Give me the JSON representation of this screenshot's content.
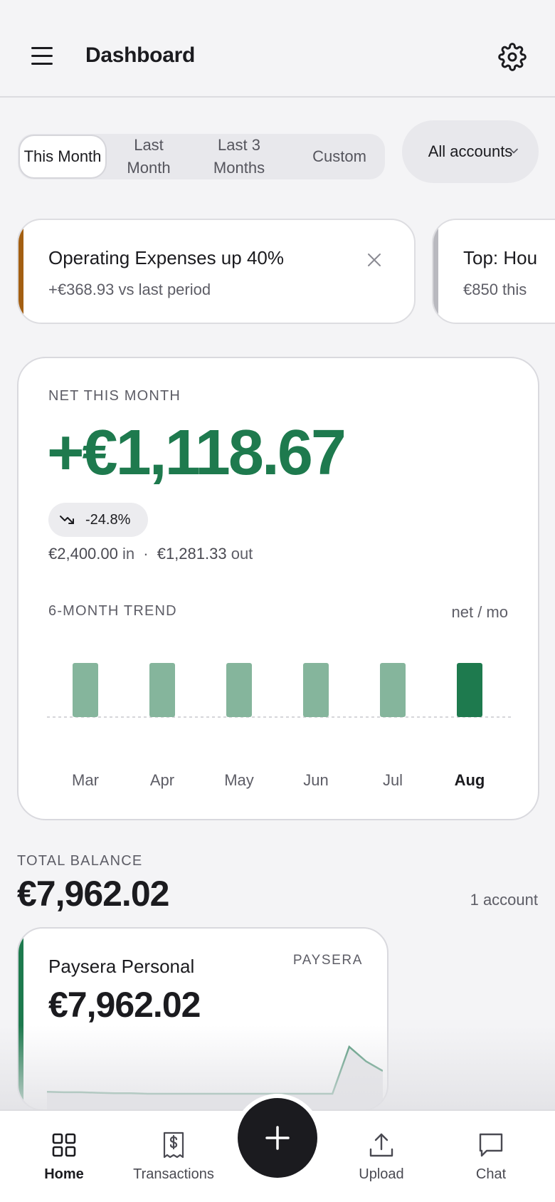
{
  "header": {
    "title": "Dashboard"
  },
  "period_tabs": [
    {
      "label": "This Month",
      "active": true
    },
    {
      "label": "Last Month",
      "active": false
    },
    {
      "label": "Last 3 Months",
      "active": false
    },
    {
      "label": "Custom",
      "active": false
    }
  ],
  "accounts_filter": {
    "label": "All accounts"
  },
  "insights": [
    {
      "title": "Operating Expenses up 40%",
      "subtitle": "+€368.93 vs last period",
      "accent_color": "#a35f12"
    },
    {
      "title": "Top: Hou",
      "subtitle": "€850 this",
      "accent_color": "#b9b9bf"
    }
  ],
  "net": {
    "label": "NET THIS MONTH",
    "value": "+€1,118.67",
    "change": "-24.8%",
    "income": "€2,400.00",
    "income_suffix": "in",
    "separator": "·",
    "expenses": "€1,281.33",
    "expenses_suffix": "out"
  },
  "trend": {
    "label": "6-MONTH TREND",
    "unit": "net / mo"
  },
  "chart_data": {
    "type": "bar",
    "title": "6-MONTH TREND",
    "categories": [
      "Mar",
      "Apr",
      "May",
      "Jun",
      "Jul",
      "Aug"
    ],
    "values": [
      1,
      1,
      1,
      1,
      1,
      1
    ],
    "highlight": "Aug",
    "colors": {
      "bar": "#85b59c",
      "highlight": "#1e7a4e"
    }
  },
  "total_balance": {
    "label": "TOTAL BALANCE",
    "value": "€7,962.02",
    "count": "1 account"
  },
  "account": {
    "name": "Paysera Personal",
    "bank": "PAYSERA",
    "balance": "€7,962.02",
    "sparkline": [
      0.07,
      0.06,
      0.06,
      0.05,
      0.04,
      0.04,
      0.03,
      0.03,
      0.03,
      0.03,
      0.03,
      0.03,
      0.03,
      0.03,
      0.03,
      0.03,
      0.03,
      0.03,
      1.0,
      0.7,
      0.5
    ]
  },
  "nav": [
    {
      "label": "Home",
      "icon": "home-grid-icon",
      "active": true
    },
    {
      "label": "Transactions",
      "icon": "receipt-icon",
      "active": false
    },
    {
      "label": "Upload",
      "icon": "upload-icon",
      "active": false
    },
    {
      "label": "Chat",
      "icon": "chat-icon",
      "active": false
    }
  ],
  "fab": {
    "icon": "plus-icon"
  },
  "colors": {
    "accent": "#1e7a4e",
    "warning": "#a35f12",
    "dark": "#1b1b1f"
  }
}
